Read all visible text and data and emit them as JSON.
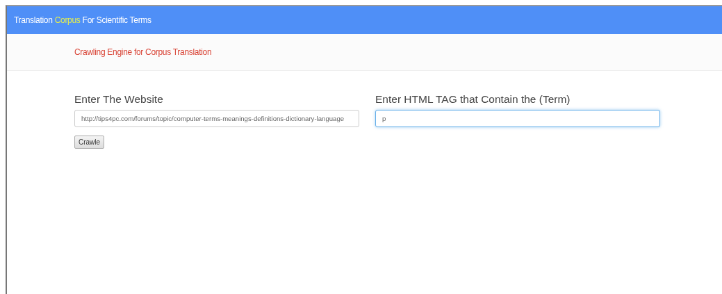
{
  "navbar": {
    "title_parts": [
      {
        "text": "Translation",
        "highlight": false
      },
      {
        "text": "Corpus",
        "highlight": true
      },
      {
        "text": "For Scientific Terms",
        "highlight": false
      }
    ]
  },
  "subheader": {
    "title": "Crawling Engine for Corpus Translation"
  },
  "form": {
    "fields": [
      {
        "label": "Enter The Website",
        "placeholder": "http://tips4pc.com/forums/topic/computer-terms-meanings-definitions-dictionary-language",
        "focused": false
      },
      {
        "label": "Enter HTML TAG that Contain the (Term)",
        "placeholder": "p",
        "focused": true
      }
    ],
    "button": "Crawle"
  }
}
